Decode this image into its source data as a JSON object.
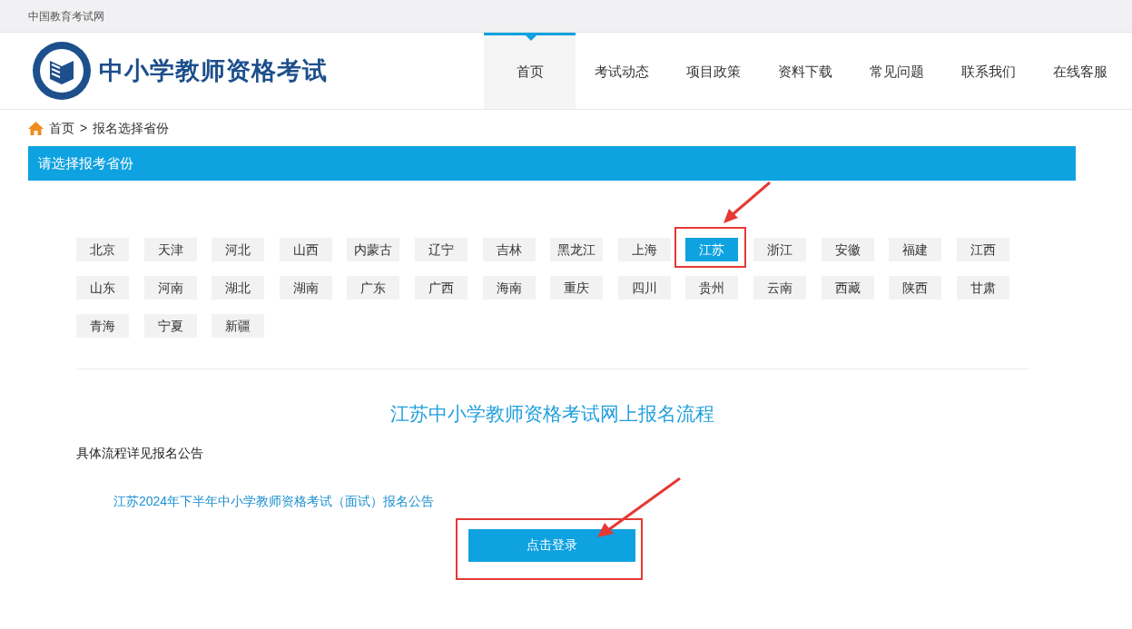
{
  "top_bar": {
    "site_name": "中国教育考试网"
  },
  "header": {
    "logo_text": "中小学教师资格考试",
    "nav": [
      {
        "label": "首页",
        "selected": true
      },
      {
        "label": "考试动态",
        "selected": false
      },
      {
        "label": "项目政策",
        "selected": false
      },
      {
        "label": "资料下载",
        "selected": false
      },
      {
        "label": "常见问题",
        "selected": false
      },
      {
        "label": "联系我们",
        "selected": false
      },
      {
        "label": "在线客服",
        "selected": false
      }
    ]
  },
  "breadcrumb": {
    "home": "首页",
    "separator": ">",
    "current": "报名选择省份"
  },
  "panel_title": "请选择报考省份",
  "provinces": [
    {
      "label": "北京",
      "selected": false
    },
    {
      "label": "天津",
      "selected": false
    },
    {
      "label": "河北",
      "selected": false
    },
    {
      "label": "山西",
      "selected": false
    },
    {
      "label": "内蒙古",
      "selected": false
    },
    {
      "label": "辽宁",
      "selected": false
    },
    {
      "label": "吉林",
      "selected": false
    },
    {
      "label": "黑龙江",
      "selected": false
    },
    {
      "label": "上海",
      "selected": false
    },
    {
      "label": "江苏",
      "selected": true
    },
    {
      "label": "浙江",
      "selected": false
    },
    {
      "label": "安徽",
      "selected": false
    },
    {
      "label": "福建",
      "selected": false
    },
    {
      "label": "江西",
      "selected": false
    },
    {
      "label": "山东",
      "selected": false
    },
    {
      "label": "河南",
      "selected": false
    },
    {
      "label": "湖北",
      "selected": false
    },
    {
      "label": "湖南",
      "selected": false
    },
    {
      "label": "广东",
      "selected": false
    },
    {
      "label": "广西",
      "selected": false
    },
    {
      "label": "海南",
      "selected": false
    },
    {
      "label": "重庆",
      "selected": false
    },
    {
      "label": "四川",
      "selected": false
    },
    {
      "label": "贵州",
      "selected": false
    },
    {
      "label": "云南",
      "selected": false
    },
    {
      "label": "西藏",
      "selected": false
    },
    {
      "label": "陕西",
      "selected": false
    },
    {
      "label": "甘肃",
      "selected": false
    },
    {
      "label": "青海",
      "selected": false
    },
    {
      "label": "宁夏",
      "selected": false
    },
    {
      "label": "新疆",
      "selected": false
    }
  ],
  "process": {
    "title": "江苏中小学教师资格考试网上报名流程",
    "note": "具体流程详见报名公告",
    "link": "江苏2024年下半年中小学教师资格考试（面试）报名公告",
    "button": "点击登录"
  }
}
